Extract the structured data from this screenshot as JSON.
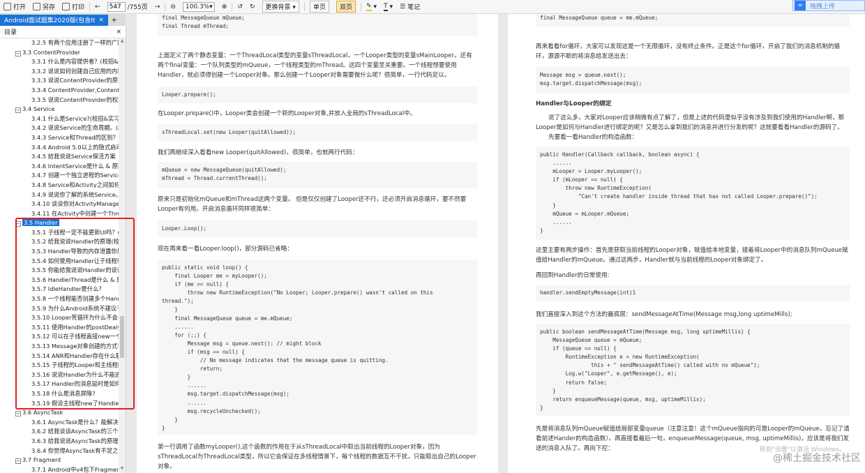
{
  "toolbar": {
    "open": "打开",
    "save_as": "另存",
    "print": "打印",
    "page_current": "547",
    "page_total": "/755页",
    "zoom": "100.3%",
    "background": "更换背景",
    "single": "单页",
    "double": "双页",
    "note": "笔记",
    "upload": "拖拽上传"
  },
  "tab": {
    "label": "Android面试题集2020版(包含It",
    "close": "×",
    "plus": "+"
  },
  "sidebar": {
    "title": "目录",
    "close": "×",
    "rows": [
      {
        "level": 3,
        "text": "3.2.5 有两个应用注册了一样的广播"
      },
      {
        "level": 2,
        "text": "3.3 ContentProvider",
        "twisty": "−"
      },
      {
        "level": 3,
        "text": "3.3.1 什么是内容提供者？(校招&实"
      },
      {
        "level": 3,
        "text": "3.3.2 说说如何创建自己应用的内容"
      },
      {
        "level": 3,
        "text": "3.3.3 说说ContentProvider的原理"
      },
      {
        "level": 3,
        "text": "3.3.4 ContentProvider,ContentRe"
      },
      {
        "level": 3,
        "text": "3.3.5 说说ContentProvider的权限"
      },
      {
        "level": 2,
        "text": "3.4 Service",
        "twisty": "−"
      },
      {
        "level": 3,
        "text": "3.4.1 什么是Service?(校招&实习)"
      },
      {
        "level": 3,
        "text": "3.4.2 说说Service的生命周期。(校"
      },
      {
        "level": 3,
        "text": "3.4.3 Service和Thread的区别？(校"
      },
      {
        "level": 3,
        "text": "3.4.4 Android 5.0以上的隐式启动"
      },
      {
        "level": 3,
        "text": "3.4.5 给我说说Service保活方案"
      },
      {
        "level": 3,
        "text": "3.4.6 IntentService是什么 & 原理"
      },
      {
        "level": 3,
        "text": "3.4.7 创建一个独立进程的Service"
      },
      {
        "level": 3,
        "text": "3.4.8 Service和Activity之间如何通"
      },
      {
        "level": 3,
        "text": "3.4.9 说说你了解的系统Service。"
      },
      {
        "level": 3,
        "text": "3.4.10 谈谈你对ActivityManager的"
      },
      {
        "level": 3,
        "text": "3.4.11 在Activity中创建一个Thread"
      },
      {
        "level": 2,
        "text": "3.5 Handler",
        "twisty": "−",
        "selected": true
      },
      {
        "level": 3,
        "text": "3.5.1 子线程一定不能更新UI吗？("
      },
      {
        "level": 3,
        "text": "3.5.2 给我说说Handler的原理(校招"
      },
      {
        "level": 3,
        "text": "3.5.3 Handler导致的内存泄露你是"
      },
      {
        "level": 3,
        "text": "3.5.4 如何使用Handler让子线程和"
      },
      {
        "level": 3,
        "text": "3.5.5 你能给我说说Handler的设计"
      },
      {
        "level": 3,
        "text": "3.5.6 HandlerThread是什么 & 原"
      },
      {
        "level": 3,
        "text": "3.5.7 IdleHandler是什么？"
      },
      {
        "level": 3,
        "text": "3.5.8 一个线程能否创建多个Hand"
      },
      {
        "level": 3,
        "text": "3.5.9 为什么Android系统不建议子"
      },
      {
        "level": 3,
        "text": "3.5.10 Looper死循环为什么不会导"
      },
      {
        "level": 3,
        "text": "3.5.11 使用Handler的postDealy("
      },
      {
        "level": 3,
        "text": "3.5.12 可以在子线程直接new一个"
      },
      {
        "level": 3,
        "text": "3.5.13 Message对象创建的方式有"
      },
      {
        "level": 3,
        "text": "3.5.14 ANR和Handler存在什么联系"
      },
      {
        "level": 3,
        "text": "3.5.15 子线程的Looper和主线程的"
      },
      {
        "level": 3,
        "text": "3.5.16 说说Handler为什么不能进行"
      },
      {
        "level": 3,
        "text": "3.5.17 Handler的消息延时是如何"
      },
      {
        "level": 3,
        "text": "3.5.18 什么是消息屏障?"
      },
      {
        "level": 3,
        "text": "3.5.19 假设主线程new了Handler"
      },
      {
        "level": 2,
        "text": "3.6 AsyncTask",
        "twisty": "−"
      },
      {
        "level": 3,
        "text": "3.6.1 AsyncTask是什么？能解决什"
      },
      {
        "level": 3,
        "text": "3.6.2 给我谈谈AsyncTask的三个泛"
      },
      {
        "level": 3,
        "text": "3.6.3 给我说说AsyncTask的原理。"
      },
      {
        "level": 3,
        "text": "3.6.4 你觉得AsyncTask有不足之处"
      },
      {
        "level": 2,
        "text": "3.7 Fragment",
        "twisty": "−"
      },
      {
        "level": 3,
        "text": "3.7.1 Android中v4包下Fragment"
      }
    ]
  },
  "page1": {
    "code0": "final MessageQueue mQueue;\nfinal Thread mThread;",
    "p1": "上面定义了两个静态变量：一个ThreadLocal类型的变量sThreadLocal，一个Looper类型的变量sMainLooper。还有两个final变量：一个队列类型的mQueue，一个线程类型的mThread。这四个变量至关重要。一个线程想要使用Handler，就必须得创建一个Looper对象。那么创建一个Looper对象需要做什么呢？很简单，一行代码足以。",
    "code1": "Looper.prepare();",
    "p2": "在Looper.prepare()中，Looper类会创建一个新的Looper对象,并放入全局的sThreadLocal中。",
    "code2": "sThreadLocal.set(new Looper(quitAllowed));",
    "p3": "我们再继续深入看看new Looper(quitAllowed)，很简单，也就两行代码：",
    "code3": "mQueue = new MessageQueue(quitAllowed);\nmThread = Thread.currentThread();",
    "p4": "原来只是初始化mQueue和mThread这两个变量。 但是仅仅创建了Looper还不行，还必须开启消息循环，要不然要Looper有何用。开启消息循环同样很简单：",
    "code4": "Looper.Loop();",
    "p5": "现在再来看一看Looper.loop()，部分源码已省略：",
    "code5": "public static void loop() {\n    final Looper me = myLooper();\n    if (me == null) {\n        throw new RuntimeException(\"No Looper; Looper.prepare() wasn't called on this\nthread.\");\n    }\n    final MessageQueue queue = me.mQueue;\n    ......\n    for (;;) {\n        Message msg = queue.next(); // might block\n        if (msg == null) {\n            // No message indicates that the message queue is quitting.\n            return;\n        }\n        ......\n        msg.target.dispatchMessage(msg);\n        ......\n        msg.recycleUnchecked();\n    }\n}",
    "p6": "第一行调用了函数myLooper(),这个函数的作用在于从sThreadLocal中取出当前线程的Looper对象，因为sThreadLocal为ThreadLocal类型，所以它会保证在多线程情景下，每个线程的数据互不干扰，只能取出自己的Looper对象。"
  },
  "page2": {
    "code0": "final MessageQueue queue = me.mQueue;",
    "p1": "再来看看for循环，大家可以发现这是一个无限循环，没有终止条件。正是这个for循环，开启了我们的消息机制的循环，源源不断的将消息给发送出去：",
    "code1": "Message msg = queue.next();\nmsg.target.dispatchMessage(msg);",
    "h1": "Handler与Looper的绑定",
    "p2": "说了这么多，大家对Looper应该稍微有点了解了，但是上述的代码里似乎没有涉及到我们使用的Handler啊，那Looper是如何与Handler进行绑定的呢？又是怎么拿到我们的消息并进行分发的呢？这就要看看Handler的源码了。",
    "p2b": "先要看一看Handler的构造函数：",
    "code2": "public Handler(Callback callback, boolean async) {\n    ......\n    mLooper = Looper.myLooper();\n    if (mLooper == null) {\n        throw new RuntimeException(\n            \"Can't create handler inside thread that has not called Looper.prepare()\");\n    }\n    mQueue = mLooper.mQueue;\n    ......\n}",
    "p3": "这里主要有两步操作：首先是获取当前线程的Looper对象，赋值给本地变量，接着将Looper中的消息队列mQueue赋值给Handler的mQueue。通过这两步，Handler就与当前线程的Looper对象绑定了。",
    "p4": "再回到Handler的日常使用:",
    "code3": "handler.sendEmptyMessage(int)1",
    "p5": "我们直接深入到这个方法的最底层：sendMessageAtTime(Message msg,long uptimeMills);",
    "code4": "public boolean sendMessageAtTime(Message msg, long uptimeMillis) {\n    MessageQueue queue = mQueue;\n    if (queue == null) {\n        RuntimeException e = new RuntimeException(\n                this + \" sendMessageAtTime() called with no mQueue\");\n        Log.w(\"Looper\", e.getMessage(), e);\n        return false;\n    }\n    return enqueueMessage(queue, msg, uptimeMillis);\n}",
    "p6": "先是将消息队列mQueue赋值给局部变量queue（注意注意！这个mQueue指向的可是Looper的mQueue，忘记了请看前述Hander的构造函数）。再直接看最后一句，enqueueMessage(queue, msg, uptimeMillis)，应该是将我们发送的消息入队了。再向下挖：",
    "watermark1": "转到\"设置\"以激活 Windows。",
    "watermark2": "@稀土掘金技术社区"
  }
}
